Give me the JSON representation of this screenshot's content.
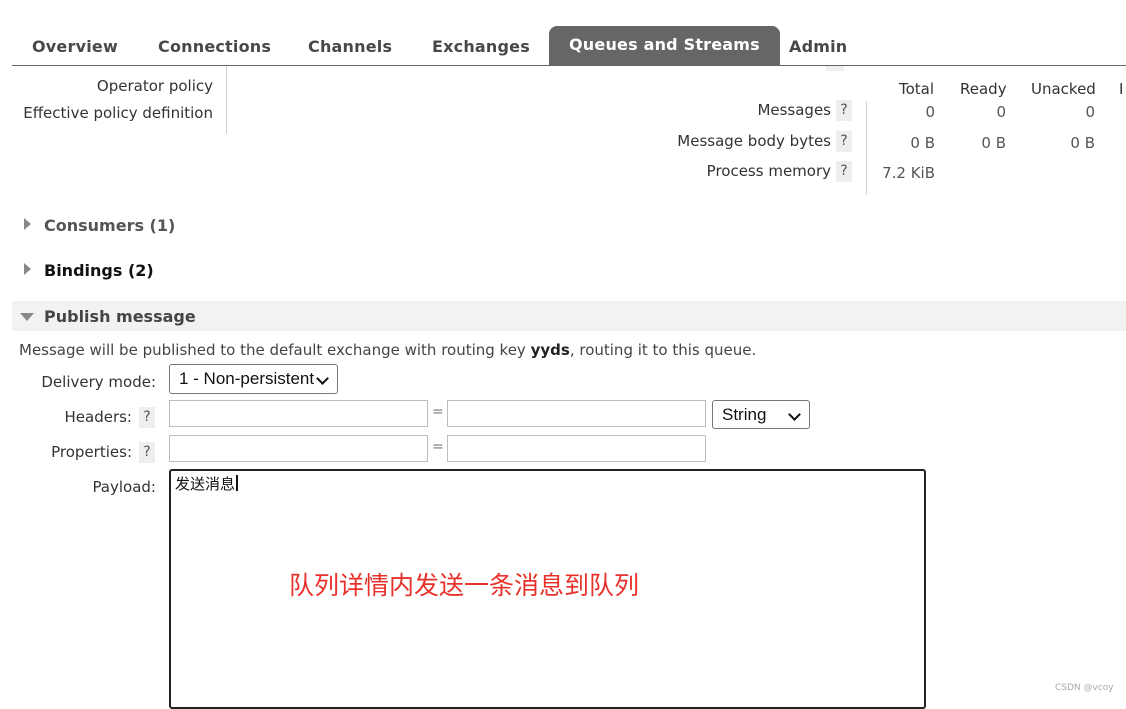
{
  "tabs": [
    "Overview",
    "Connections",
    "Channels",
    "Exchanges",
    "Queues and Streams",
    "Admin"
  ],
  "active_tab": "Queues and Streams",
  "info": {
    "operator_policy_label": "Operator policy",
    "effective_policy_label": "Effective policy definition"
  },
  "stats": {
    "columns": [
      "Total",
      "Ready",
      "Unacked",
      "I"
    ],
    "rows": [
      {
        "label": "Messages",
        "help": "?",
        "values": [
          "0",
          "0",
          "0"
        ]
      },
      {
        "label": "Message body bytes",
        "help": "?",
        "values": [
          "0 B",
          "0 B",
          "0 B"
        ]
      },
      {
        "label": "Process memory",
        "help": "?",
        "values": [
          "7.2 KiB"
        ]
      }
    ]
  },
  "sections": {
    "consumers": "Consumers (1)",
    "bindings": "Bindings (2)",
    "publish": "Publish message"
  },
  "publish": {
    "intro_before": "Message will be published to the default exchange with routing key ",
    "routing_key": "yyds",
    "intro_after": ", routing it to this queue.",
    "delivery_mode_label": "Delivery mode:",
    "delivery_mode_value": "1 - Non-persistent",
    "headers_label": "Headers:",
    "headers_help": "?",
    "headers_key": "",
    "headers_value": "",
    "headers_type": "String",
    "equals": "=",
    "properties_label": "Properties:",
    "properties_help": "?",
    "properties_key": "",
    "properties_value": "",
    "payload_label": "Payload:",
    "payload_value": "发送消息"
  },
  "annotation": {
    "text": "队列详情内发送一条消息到队列",
    "color": "#e8312a"
  },
  "watermark": "CSDN @vcoy"
}
